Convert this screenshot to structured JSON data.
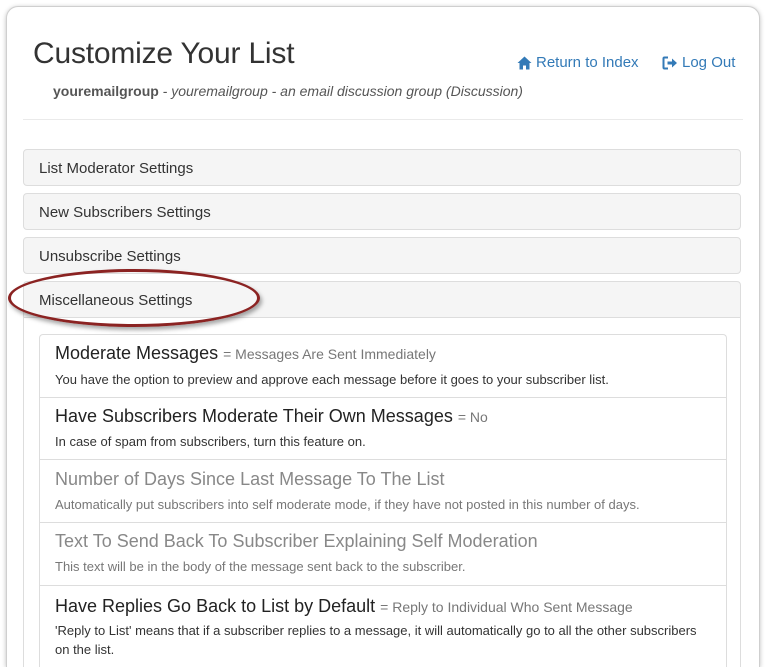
{
  "header": {
    "title": "Customize Your List",
    "list_name": "youremailgroup",
    "list_description": " - youremailgroup - an email discussion group (Discussion)",
    "links": {
      "return_to_index": "Return to Index",
      "log_out": "Log Out"
    }
  },
  "panels": {
    "moderator": "List Moderator Settings",
    "new_subscribers": "New Subscribers Settings",
    "unsubscribe": "Unsubscribe Settings",
    "miscellaneous": "Miscellaneous Settings"
  },
  "settings": [
    {
      "title": "Moderate Messages",
      "value": "= Messages Are Sent Immediately",
      "description": "You have the option to preview and approve each message before it goes to your subscriber list.",
      "enabled": true
    },
    {
      "title": "Have Subscribers Moderate Their Own Messages",
      "value": "= No",
      "description": "In case of spam from subscribers, turn this feature on.",
      "enabled": true
    },
    {
      "title": "Number of Days Since Last Message To The List",
      "value": "",
      "description": "Automatically put subscribers into self moderate mode, if they have not posted in this number of days.",
      "enabled": false
    },
    {
      "title": "Text To Send Back To Subscriber Explaining Self Moderation",
      "value": "",
      "description": "This text will be in the body of the message sent back to the subscriber.",
      "enabled": false
    },
    {
      "title": "Have Replies Go Back to List by Default",
      "value": "= Reply to Individual Who Sent Message",
      "description": "'Reply to List' means that if a subscriber replies to a message, it will automatically go to all the other subscribers on the list.",
      "enabled": true
    }
  ],
  "colors": {
    "link": "#337ab7",
    "highlight_oval": "#8b2322",
    "panel_bg": "#f5f5f5"
  },
  "icons": {
    "return_to_index": "home-icon",
    "log_out": "log-out-icon"
  }
}
